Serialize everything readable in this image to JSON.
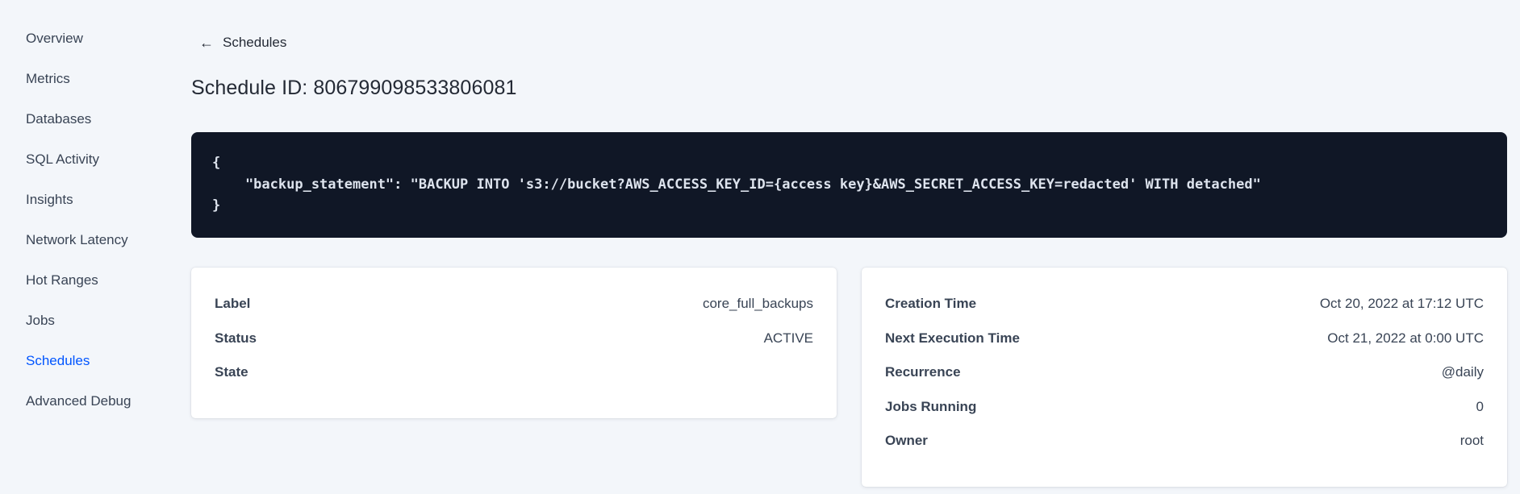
{
  "sidebar": {
    "items": [
      {
        "label": "Overview",
        "active": false
      },
      {
        "label": "Metrics",
        "active": false
      },
      {
        "label": "Databases",
        "active": false
      },
      {
        "label": "SQL Activity",
        "active": false
      },
      {
        "label": "Insights",
        "active": false
      },
      {
        "label": "Network Latency",
        "active": false
      },
      {
        "label": "Hot Ranges",
        "active": false
      },
      {
        "label": "Jobs",
        "active": false
      },
      {
        "label": "Schedules",
        "active": true
      },
      {
        "label": "Advanced Debug",
        "active": false
      }
    ]
  },
  "header": {
    "back_icon": "←",
    "back_label": "Schedules",
    "title": "Schedule ID: 806799098533806081"
  },
  "code_block": {
    "content": "{\n    \"backup_statement\": \"BACKUP INTO 's3://bucket?AWS_ACCESS_KEY_ID={access key}&AWS_SECRET_ACCESS_KEY=redacted' WITH detached\"\n}"
  },
  "cards": {
    "left": {
      "rows": [
        {
          "label": "Label",
          "value": "core_full_backups"
        },
        {
          "label": "Status",
          "value": "ACTIVE"
        },
        {
          "label": "State",
          "value": ""
        }
      ]
    },
    "right": {
      "rows": [
        {
          "label": "Creation Time",
          "value": "Oct 20, 2022 at 17:12 UTC"
        },
        {
          "label": "Next Execution Time",
          "value": "Oct 21, 2022 at 0:00 UTC"
        },
        {
          "label": "Recurrence",
          "value": "@daily"
        },
        {
          "label": "Jobs Running",
          "value": "0"
        },
        {
          "label": "Owner",
          "value": "root"
        }
      ]
    }
  },
  "colors": {
    "accent_blue": "#0055ff",
    "page_background": "#f3f6fa",
    "code_background": "#101726",
    "code_text": "#dde3ed",
    "text_primary": "#394455",
    "heading_text": "#242a35",
    "card_background": "#ffffff"
  }
}
